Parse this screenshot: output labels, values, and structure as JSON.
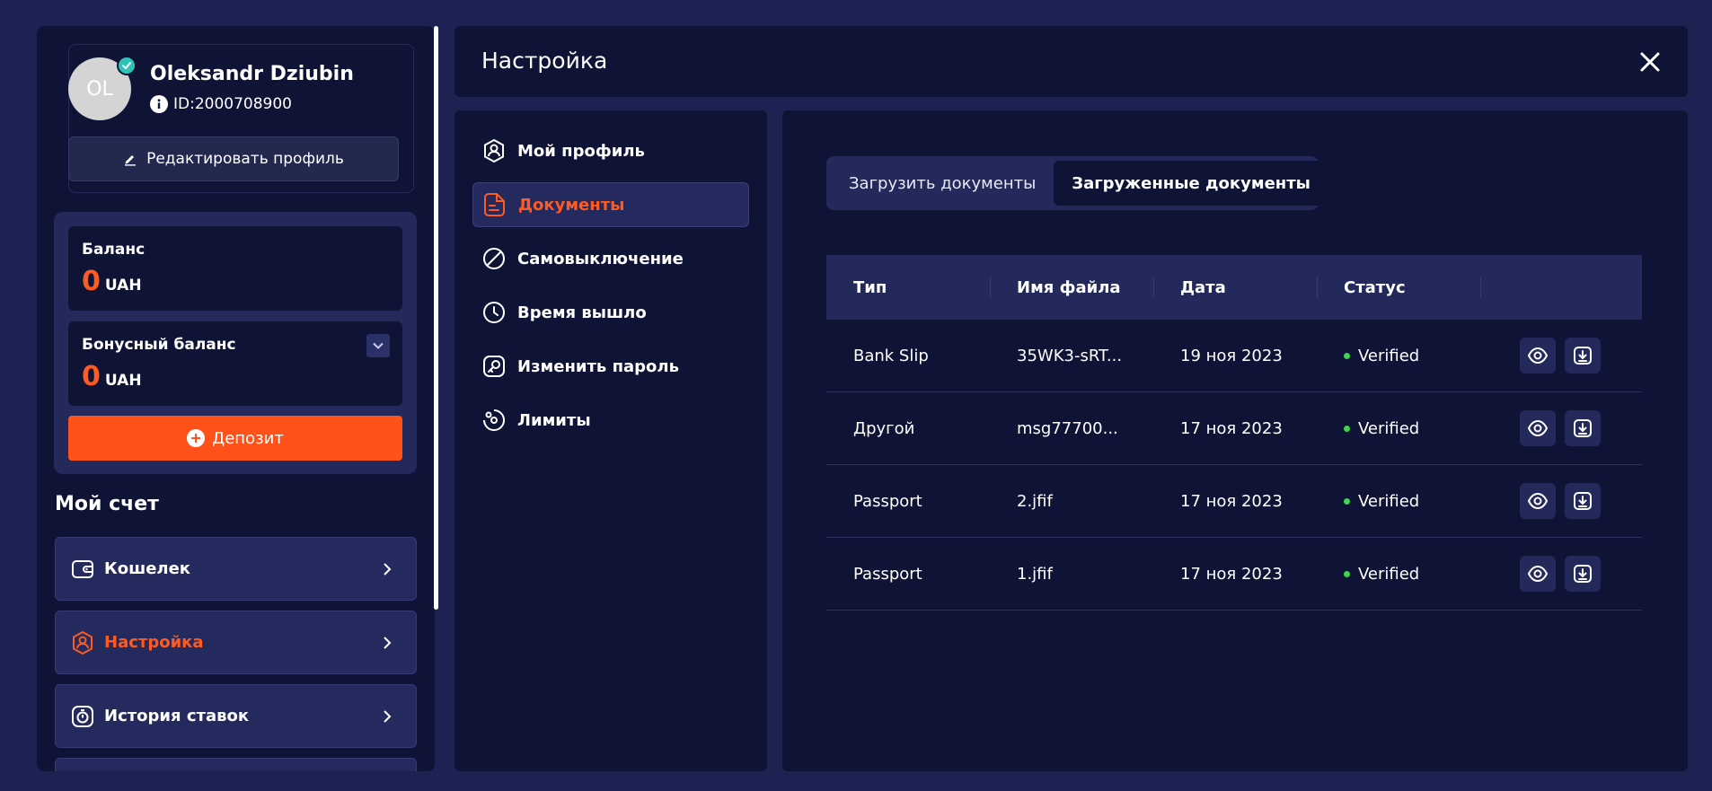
{
  "profile": {
    "avatar_initials": "OL",
    "name": "Oleksandr Dziubin",
    "id_text": "ID:2000708900",
    "edit_label": "Редактировать профиль"
  },
  "balance": {
    "main_label": "Баланс",
    "main_amount": "0",
    "main_currency": "UAH",
    "bonus_label": "Бонусный баланс",
    "bonus_amount": "0",
    "bonus_currency": "UAH",
    "deposit_label": "Депозит"
  },
  "account": {
    "title": "Мой счет",
    "items": [
      {
        "label": "Кошелек",
        "icon": "wallet-icon",
        "active": false
      },
      {
        "label": "Настройка",
        "icon": "user-settings-icon",
        "active": true
      },
      {
        "label": "История ставок",
        "icon": "history-icon",
        "active": false
      }
    ]
  },
  "settings": {
    "title": "Настройка",
    "menu": [
      {
        "label": "Мой профиль",
        "icon": "profile-icon",
        "active": false
      },
      {
        "label": "Документы",
        "icon": "document-icon",
        "active": true
      },
      {
        "label": "Самовыключение",
        "icon": "block-icon",
        "active": false
      },
      {
        "label": "Время вышло",
        "icon": "clock-icon",
        "active": false
      },
      {
        "label": "Изменить пароль",
        "icon": "key-icon",
        "active": false
      },
      {
        "label": "Лимиты",
        "icon": "limits-icon",
        "active": false
      }
    ]
  },
  "documents": {
    "tabs": [
      {
        "label": "Загрузить документы",
        "active": false
      },
      {
        "label": "Загруженные документы",
        "active": true
      }
    ],
    "columns": [
      "Тип",
      "Имя файла",
      "Дата",
      "Статус"
    ],
    "rows": [
      {
        "type": "Bank Slip",
        "file": "35WK3-sRT...",
        "date": "19 ноя 2023",
        "status": "Verified"
      },
      {
        "type": "Другой",
        "file": "msg77700...",
        "date": "17 ноя 2023",
        "status": "Verified"
      },
      {
        "type": "Passport",
        "file": "2.jfif",
        "date": "17 ноя 2023",
        "status": "Verified"
      },
      {
        "type": "Passport",
        "file": "1.jfif",
        "date": "17 ноя 2023",
        "status": "Verified"
      }
    ]
  },
  "colors": {
    "background": "#1d2252",
    "panel": "#0f1436",
    "accent": "#ff5119",
    "status_verified": "#3fd44a",
    "badge": "#2fc3b8"
  }
}
